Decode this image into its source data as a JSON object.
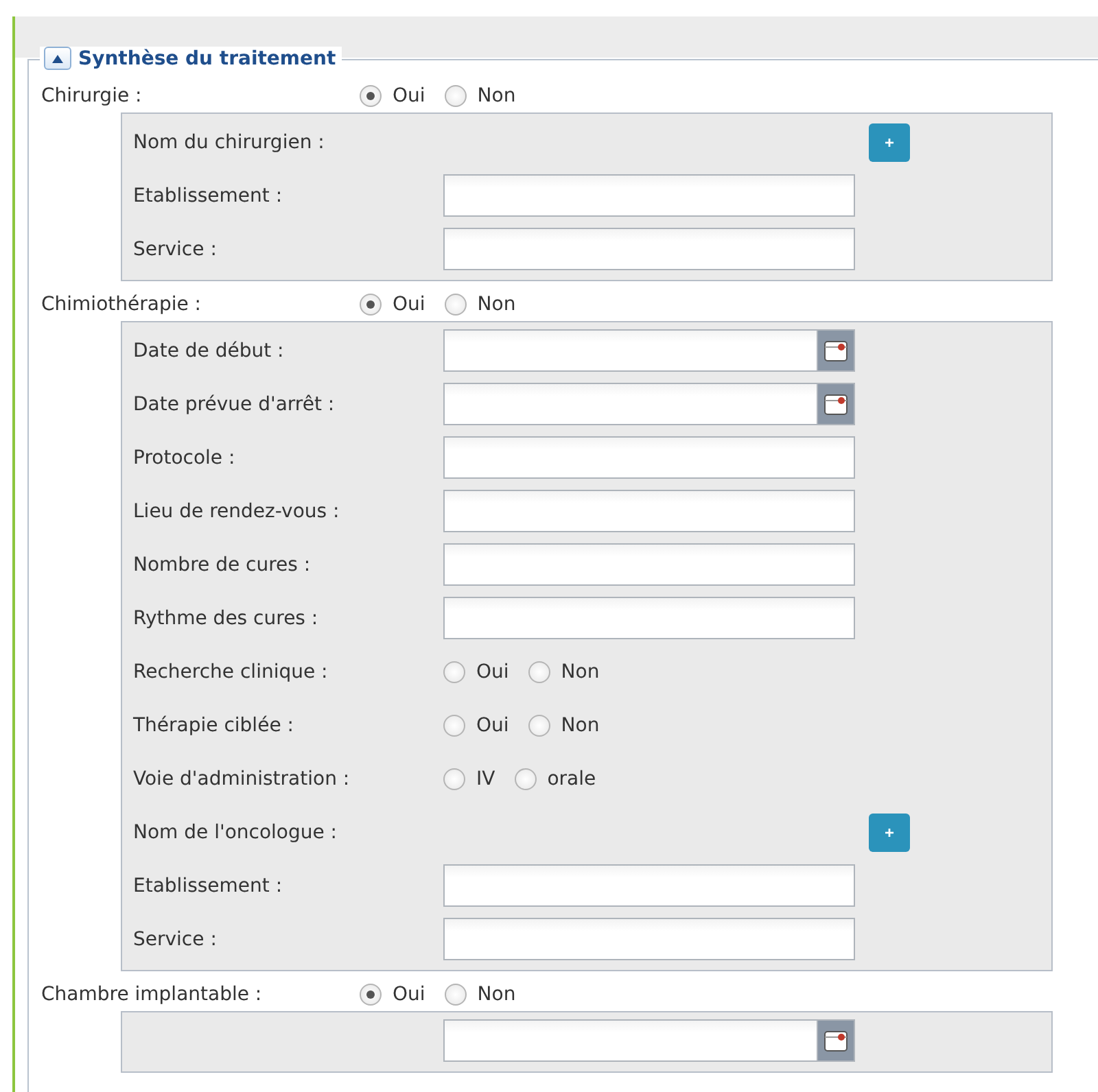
{
  "fieldset": {
    "title": "Synthèse du traitement",
    "expanded": true
  },
  "sections": [
    {
      "label": "Chirurgie :",
      "options": [
        {
          "label": "Oui",
          "selected": true
        },
        {
          "label": "Non",
          "selected": false
        }
      ],
      "panel": [
        {
          "kind": "add",
          "label": "Nom du chirurgien :",
          "button": "+"
        },
        {
          "kind": "text",
          "label": "Etablissement :"
        },
        {
          "kind": "text",
          "label": "Service :"
        }
      ]
    },
    {
      "label": "Chimiothérapie :",
      "options": [
        {
          "label": "Oui",
          "selected": true
        },
        {
          "label": "Non",
          "selected": false
        }
      ],
      "panel": [
        {
          "kind": "date",
          "label": "Date de début :"
        },
        {
          "kind": "date",
          "label": "Date prévue d'arrêt :"
        },
        {
          "kind": "text",
          "label": "Protocole :"
        },
        {
          "kind": "text",
          "label": "Lieu de rendez-vous :"
        },
        {
          "kind": "text",
          "label": "Nombre de cures :"
        },
        {
          "kind": "text",
          "label": "Rythme des cures :"
        },
        {
          "kind": "radio",
          "label": "Recherche clinique :",
          "options": [
            {
              "label": "Oui",
              "selected": false
            },
            {
              "label": "Non",
              "selected": false
            }
          ]
        },
        {
          "kind": "radio",
          "label": "Thérapie ciblée :",
          "options": [
            {
              "label": "Oui",
              "selected": false
            },
            {
              "label": "Non",
              "selected": false
            }
          ]
        },
        {
          "kind": "radio",
          "label": "Voie d'administration :",
          "options": [
            {
              "label": "IV",
              "selected": false
            },
            {
              "label": "orale",
              "selected": false
            }
          ]
        },
        {
          "kind": "add",
          "label": "Nom de l'oncologue :",
          "button": "+"
        },
        {
          "kind": "text",
          "label": "Etablissement :"
        },
        {
          "kind": "text",
          "label": "Service :"
        }
      ]
    },
    {
      "label": "Chambre implantable :",
      "options": [
        {
          "label": "Oui",
          "selected": true
        },
        {
          "label": "Non",
          "selected": false
        }
      ],
      "panel": [
        {
          "kind": "date"
        }
      ]
    }
  ]
}
